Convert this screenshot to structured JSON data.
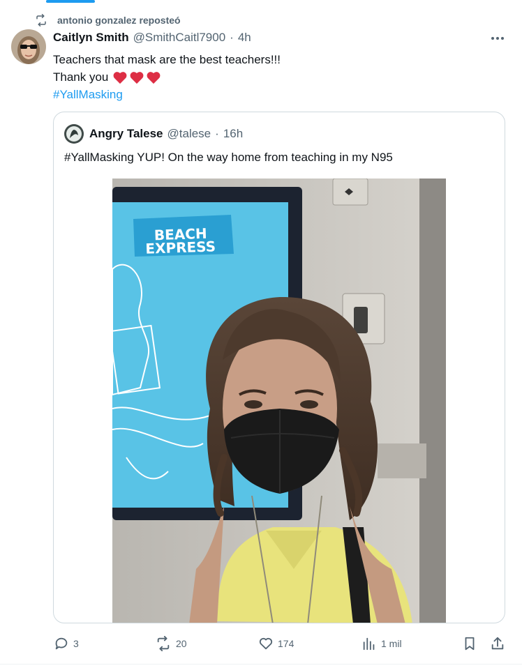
{
  "repost": {
    "label": "antonio gonzalez reposteó",
    "icon": "repost-icon"
  },
  "tweet": {
    "author_name": "Caitlyn Smith",
    "handle": "@SmithCaitl7900",
    "separator": "·",
    "time": "4h",
    "more_icon": "more-icon",
    "text_line1": "Teachers that mask are the best teachers!!!",
    "text_line2": "Thank you",
    "hashtag": "#YallMasking",
    "heart_color": "#e0245e"
  },
  "quote": {
    "author_name": "Angry Talese",
    "handle": "@talese",
    "separator": "·",
    "time": "16h",
    "text": "#YallMasking YUP! On the way home from teaching in my N95",
    "photo_sign_line1": "BEACH",
    "photo_sign_line2": "EXPRESS"
  },
  "actions": {
    "reply_count": "3",
    "repost_count": "20",
    "like_count": "174",
    "views_count": "1 mil",
    "reply_icon": "reply-icon",
    "repost_icon": "repost-icon",
    "like_icon": "heart-icon",
    "views_icon": "views-icon",
    "bookmark_icon": "bookmark-icon",
    "share_icon": "share-icon"
  },
  "colors": {
    "accent": "#1d9bf0",
    "secondary_text": "#536471",
    "border": "#cfd9de"
  }
}
